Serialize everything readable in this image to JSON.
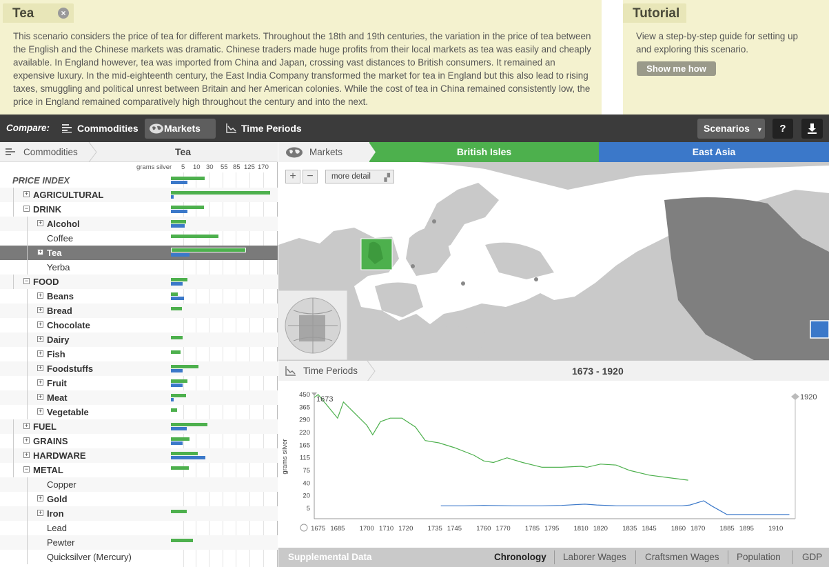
{
  "scenario": {
    "title": "Tea",
    "description": "This scenario considers the price of tea for different markets. Throughout the 18th and 19th centuries, the variation in the price of tea between the English and the Chinese markets was dramatic. Chinese traders made huge profits from their local markets as tea was easily and cheaply available. In England however, tea was imported from China and Japan, crossing vast distances to British consumers. It remained an expensive luxury. In the mid-eighteenth century, the East India Company transformed the market for tea in England but this also lead to rising taxes, smuggling and political unrest between Britain and her American colonies. While the cost of tea in China remained consistently low, the price in England remained comparatively high throughout the century and into the next."
  },
  "tutorial": {
    "title": "Tutorial",
    "text": "View a step-by-step guide for setting up and exploring this scenario.",
    "button": "Show me how"
  },
  "toolbar": {
    "compare_label": "Compare:",
    "commodities": "Commodities",
    "markets": "Markets",
    "time_periods": "Time Periods",
    "scenarios": "Scenarios",
    "help": "?"
  },
  "commodities_panel": {
    "breadcrumb": "Commodities",
    "current": "Tea",
    "scale_unit": "grams silver",
    "scale_ticks": [
      "5",
      "10",
      "30",
      "55",
      "85",
      "125",
      "170"
    ],
    "rows": [
      {
        "label": "PRICE INDEX",
        "level": 0,
        "style": "italic",
        "toggle": "",
        "green": 0.34,
        "blue": 0.17
      },
      {
        "label": "AGRICULTURAL",
        "level": 1,
        "toggle": "+",
        "green": 1.0,
        "blue": 0.03
      },
      {
        "label": "DRINK",
        "level": 1,
        "toggle": "-",
        "green": 0.33,
        "blue": 0.17
      },
      {
        "label": "Alcohol",
        "level": 2,
        "toggle": "+",
        "green": 0.15,
        "blue": 0.14
      },
      {
        "label": "Coffee",
        "level": 2,
        "toggle": "",
        "green": 0.48,
        "blue": 0
      },
      {
        "label": "Tea",
        "level": 2,
        "toggle": "+",
        "green": 0.76,
        "blue": 0.19,
        "selected": true
      },
      {
        "label": "Yerba",
        "level": 2,
        "toggle": "",
        "green": 0,
        "blue": 0
      },
      {
        "label": "FOOD",
        "level": 1,
        "toggle": "-",
        "green": 0.17,
        "blue": 0.12
      },
      {
        "label": "Beans",
        "level": 2,
        "toggle": "+",
        "green": 0.07,
        "blue": 0.13
      },
      {
        "label": "Bread",
        "level": 2,
        "toggle": "+",
        "green": 0.11,
        "blue": 0
      },
      {
        "label": "Chocolate",
        "level": 2,
        "toggle": "+",
        "green": 0,
        "blue": 0
      },
      {
        "label": "Dairy",
        "level": 2,
        "toggle": "+",
        "green": 0.12,
        "blue": 0
      },
      {
        "label": "Fish",
        "level": 2,
        "toggle": "+",
        "green": 0.1,
        "blue": 0
      },
      {
        "label": "Foodstuffs",
        "level": 2,
        "toggle": "+",
        "green": 0.28,
        "blue": 0.12
      },
      {
        "label": "Fruit",
        "level": 2,
        "toggle": "+",
        "green": 0.17,
        "blue": 0.12
      },
      {
        "label": "Meat",
        "level": 2,
        "toggle": "+",
        "green": 0.15,
        "blue": 0.03
      },
      {
        "label": "Vegetable",
        "level": 2,
        "toggle": "+",
        "green": 0.06,
        "blue": 0
      },
      {
        "label": "FUEL",
        "level": 1,
        "toggle": "+",
        "green": 0.37,
        "blue": 0.16
      },
      {
        "label": "GRAINS",
        "level": 1,
        "toggle": "+",
        "green": 0.19,
        "blue": 0.12
      },
      {
        "label": "HARDWARE",
        "level": 1,
        "toggle": "+",
        "green": 0.27,
        "blue": 0.35
      },
      {
        "label": "METAL",
        "level": 1,
        "toggle": "-",
        "green": 0.18,
        "blue": 0
      },
      {
        "label": "Copper",
        "level": 2,
        "toggle": "",
        "green": 0,
        "blue": 0
      },
      {
        "label": "Gold",
        "level": 2,
        "toggle": "+",
        "green": 0,
        "blue": 0
      },
      {
        "label": "Iron",
        "level": 2,
        "toggle": "+",
        "green": 0.16,
        "blue": 0
      },
      {
        "label": "Lead",
        "level": 2,
        "toggle": "",
        "green": 0,
        "blue": 0
      },
      {
        "label": "Pewter",
        "level": 2,
        "toggle": "",
        "green": 0.22,
        "blue": 0
      },
      {
        "label": "Quicksilver (Mercury)",
        "level": 2,
        "toggle": "",
        "green": 0,
        "blue": 0
      }
    ]
  },
  "markets_panel": {
    "label": "Markets",
    "market_a": "British Isles",
    "market_b": "East Asia",
    "more_detail": "more detail",
    "zoom_in": "+",
    "zoom_out": "−"
  },
  "time_panel": {
    "label": "Time Periods",
    "range": "1673 - 1920",
    "start_marker": "1673",
    "end_marker": "1920"
  },
  "supplemental": {
    "title": "Supplemental Data",
    "tabs": [
      "Chronology",
      "Laborer Wages",
      "Craftsmen Wages",
      "Population",
      "GDP"
    ],
    "active": "Chronology"
  },
  "colors": {
    "green": "#4db04d",
    "blue": "#3b78c9",
    "toolbar": "#3b3b3b",
    "panel": "#f4f2cf"
  },
  "chart_data": {
    "type": "line",
    "xlabel": "",
    "ylabel": "grams silver",
    "x_ticks": [
      "1675",
      "1685",
      "1700",
      "1710",
      "1720",
      "1735",
      "1745",
      "1760",
      "1770",
      "1785",
      "1795",
      "1810",
      "1820",
      "1835",
      "1845",
      "1860",
      "1870",
      "1885",
      "1895",
      "1910"
    ],
    "y_ticks": [
      "450",
      "365",
      "290",
      "220",
      "165",
      "115",
      "75",
      "40",
      "20",
      "5"
    ],
    "series": [
      {
        "color": "#4db04d",
        "points": [
          [
            1673,
            430
          ],
          [
            1675,
            450
          ],
          [
            1685,
            300
          ],
          [
            1688,
            400
          ],
          [
            1700,
            260
          ],
          [
            1703,
            210
          ],
          [
            1707,
            280
          ],
          [
            1712,
            300
          ],
          [
            1718,
            300
          ],
          [
            1725,
            250
          ],
          [
            1730,
            185
          ],
          [
            1737,
            175
          ],
          [
            1745,
            155
          ],
          [
            1755,
            125
          ],
          [
            1760,
            105
          ],
          [
            1765,
            100
          ],
          [
            1772,
            115
          ],
          [
            1780,
            100
          ],
          [
            1790,
            85
          ],
          [
            1800,
            85
          ],
          [
            1810,
            88
          ],
          [
            1813,
            85
          ],
          [
            1820,
            95
          ],
          [
            1828,
            92
          ],
          [
            1835,
            75
          ],
          [
            1845,
            62
          ],
          [
            1855,
            55
          ],
          [
            1865,
            48
          ]
        ]
      },
      {
        "color": "#3b78c9",
        "points": [
          [
            1738,
            8
          ],
          [
            1750,
            8
          ],
          [
            1760,
            8.5
          ],
          [
            1775,
            8
          ],
          [
            1790,
            8
          ],
          [
            1800,
            8.5
          ],
          [
            1812,
            10
          ],
          [
            1818,
            9
          ],
          [
            1828,
            8
          ],
          [
            1845,
            8
          ],
          [
            1862,
            8
          ],
          [
            1866,
            9
          ],
          [
            1873,
            14
          ],
          [
            1877,
            8
          ],
          [
            1885,
            2
          ],
          [
            1900,
            2
          ],
          [
            1917,
            2
          ]
        ]
      }
    ]
  }
}
